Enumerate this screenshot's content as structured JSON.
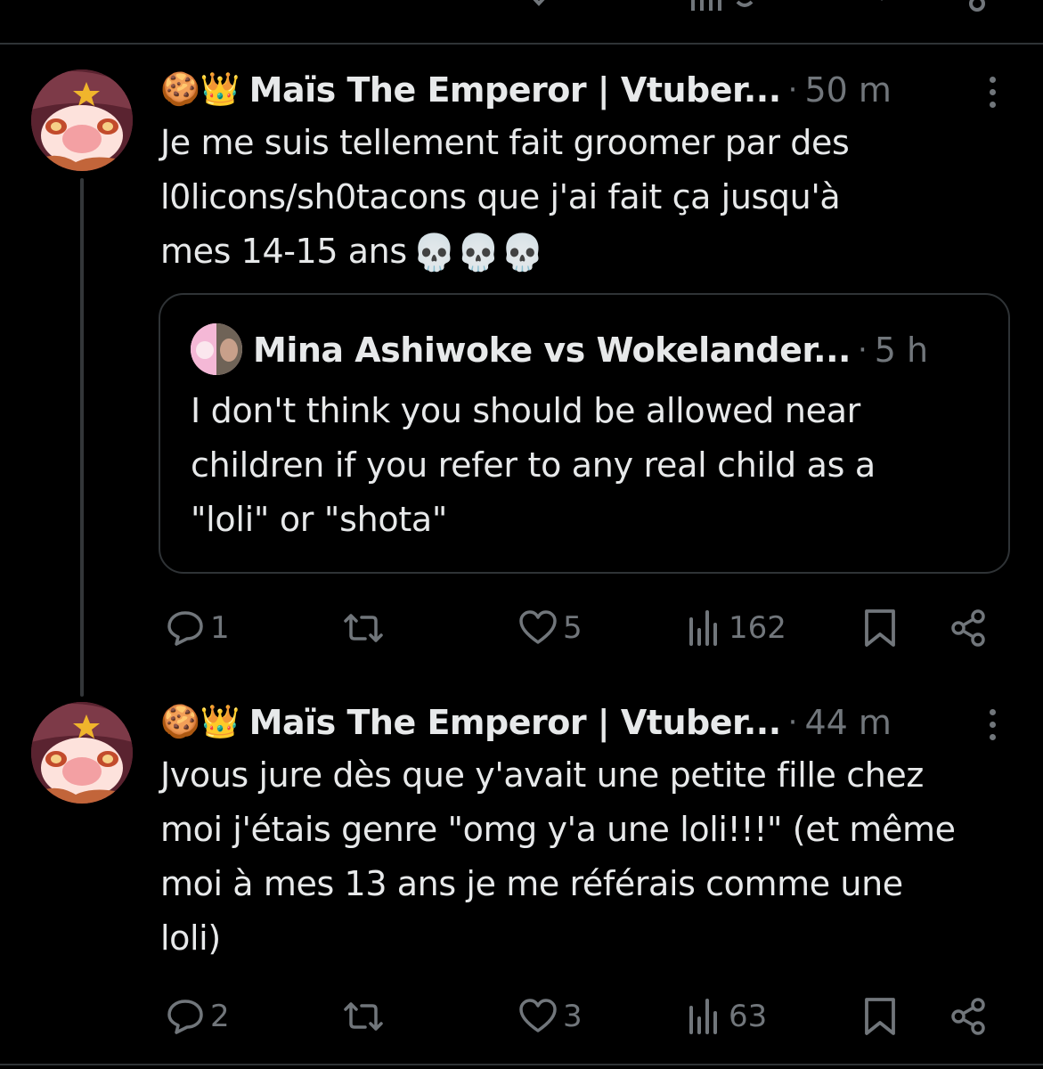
{
  "colors": {
    "background": "#000000",
    "text": "#e7e9ea",
    "muted": "#71767b",
    "border": "#2f3336"
  },
  "tweets": [
    {
      "emoji": "🍪👑",
      "name": "Maïs The Emperor | Vtuber...",
      "time": "50 m",
      "text_lines": [
        "Je me suis tellement fait groomer par des",
        "l0licons/sh0tacons que j'ai fait ça jusqu'à",
        "mes 14-15 ans"
      ],
      "trailing_emoji": "💀💀💀",
      "quote": {
        "name": "Mina Ashiwoke vs Wokelander...",
        "time": "5 h",
        "text_lines": [
          "I don't think you should be allowed near",
          "children if you refer to any real child as a",
          "\"loli\" or \"shota\""
        ]
      },
      "actions": {
        "replies": "1",
        "retweets": "",
        "likes": "5",
        "views": "162"
      }
    },
    {
      "emoji": "🍪👑",
      "name": "Maïs The Emperor | Vtuber...",
      "time": "44 m",
      "text_lines": [
        "Jvous jure dès que y'avait une petite fille chez",
        "moi j'étais genre \"omg y'a une loli!!!\" (et même",
        "moi à mes 13 ans je me référais comme une",
        "loli)"
      ],
      "actions": {
        "replies": "2",
        "retweets": "",
        "likes": "3",
        "views": "63"
      }
    }
  ],
  "icons": {
    "reply": "reply-icon",
    "retweet": "retweet-icon",
    "like": "heart-icon",
    "views": "views-icon",
    "bookmark": "bookmark-icon",
    "share": "share-icon",
    "more": "more-icon"
  }
}
